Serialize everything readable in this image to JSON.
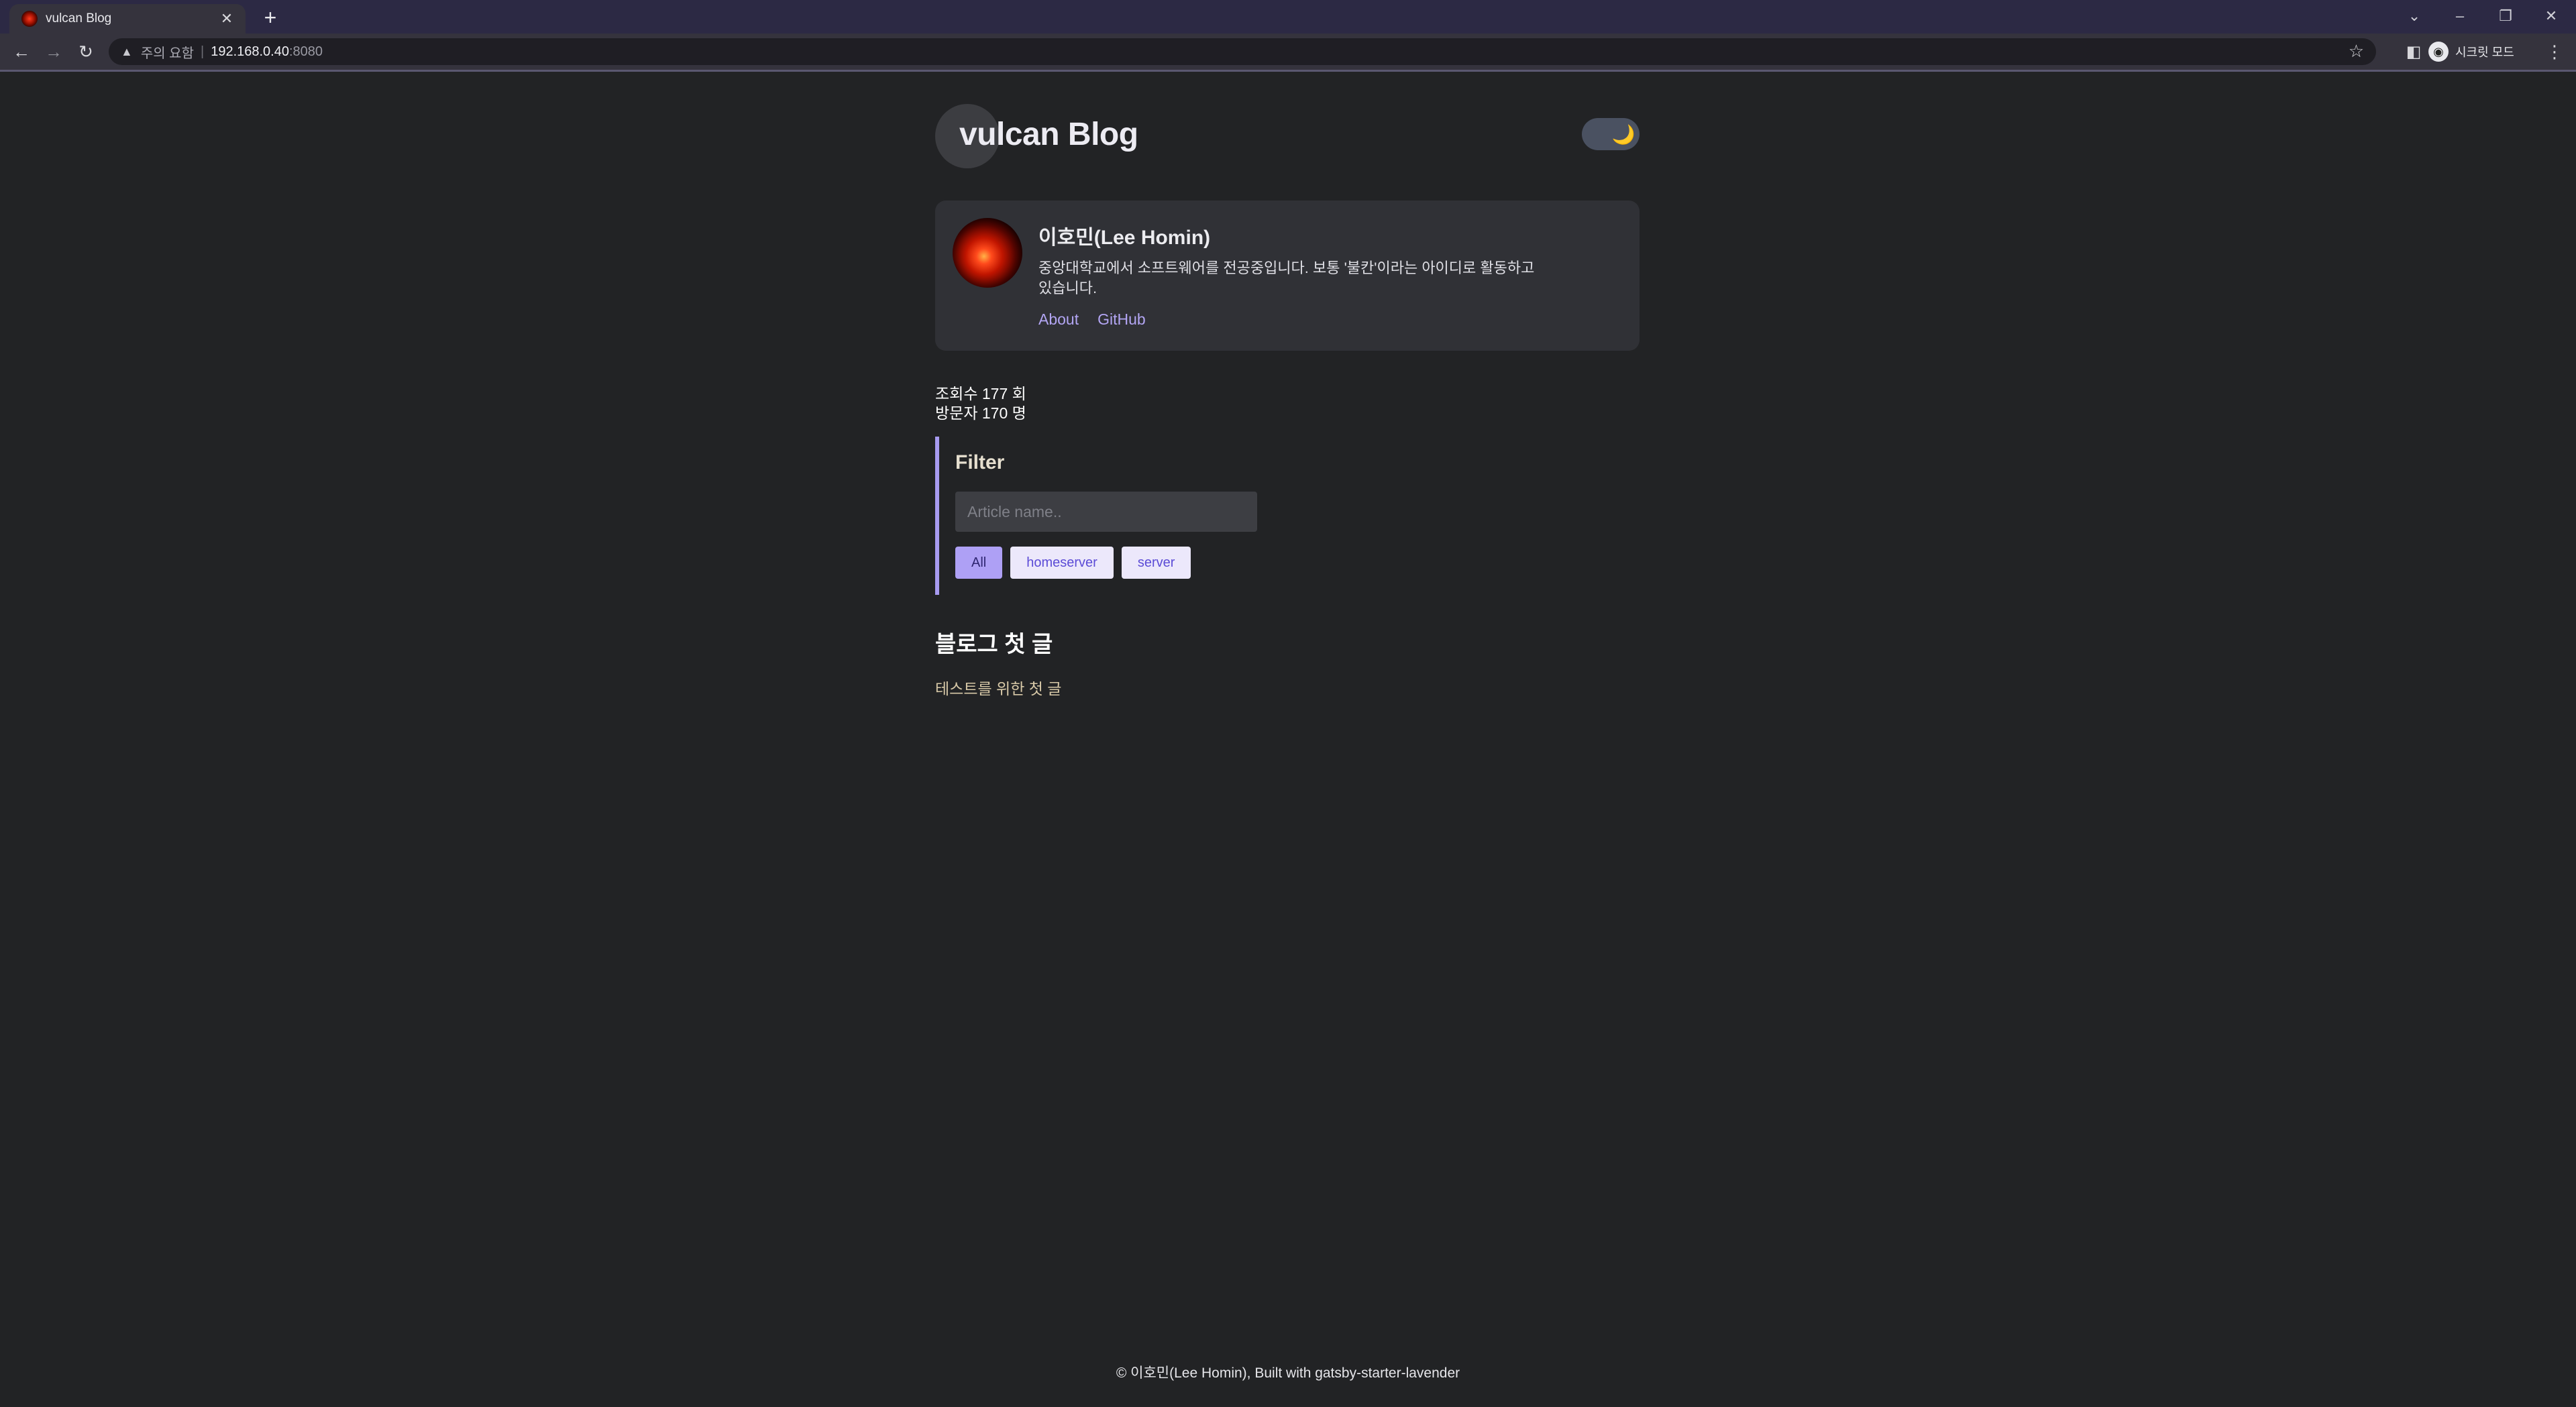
{
  "browser": {
    "tab": {
      "title": "vulcan Blog",
      "close_glyph": "✕",
      "favicon_icon": "volcano-favicon-icon"
    },
    "new_tab_glyph": "+",
    "window_controls": {
      "tabsearch": "⌄",
      "minimize": "–",
      "restore": "❐",
      "close": "✕"
    },
    "nav": {
      "back": "←",
      "forward": "→",
      "reload": "↻"
    },
    "address": {
      "warning_glyph": "▲",
      "warning_text": "주의 요함",
      "separator": "|",
      "host": "192.168.0.40",
      "port": ":8080",
      "star_glyph": "☆"
    },
    "side_panel_glyph": "◧",
    "menu_glyph": "⋮",
    "profile": {
      "avatar_glyph": "◉",
      "label": "시크릿 모드"
    }
  },
  "site": {
    "title": "vulcan Blog",
    "theme_toggle_glyph": "🌙"
  },
  "bio": {
    "name": "이호민(Lee Homin)",
    "description": "중앙대학교에서 소프트웨어를 전공중입니다. 보통 '불칸'이라는 아이디로 활동하고 있습니다.",
    "links": [
      {
        "label": "About"
      },
      {
        "label": "GitHub"
      }
    ]
  },
  "stats": {
    "views": "조회수 177 회",
    "visitors": "방문자 170 명"
  },
  "filter": {
    "title": "Filter",
    "placeholder": "Article name..",
    "tags": [
      {
        "label": "All",
        "active": true
      },
      {
        "label": "homeserver",
        "active": false
      },
      {
        "label": "server",
        "active": false
      }
    ]
  },
  "posts": [
    {
      "title": "블로그 첫 글",
      "excerpt": "테스트를 위한 첫 글"
    }
  ],
  "footer": {
    "text": "© 이호민(Lee Homin), Built with gatsby-starter-lavender"
  },
  "colors": {
    "page_bg": "#222325",
    "accent": "#a79af0",
    "link": "#b3a6f4",
    "card_bg": "#303136"
  }
}
